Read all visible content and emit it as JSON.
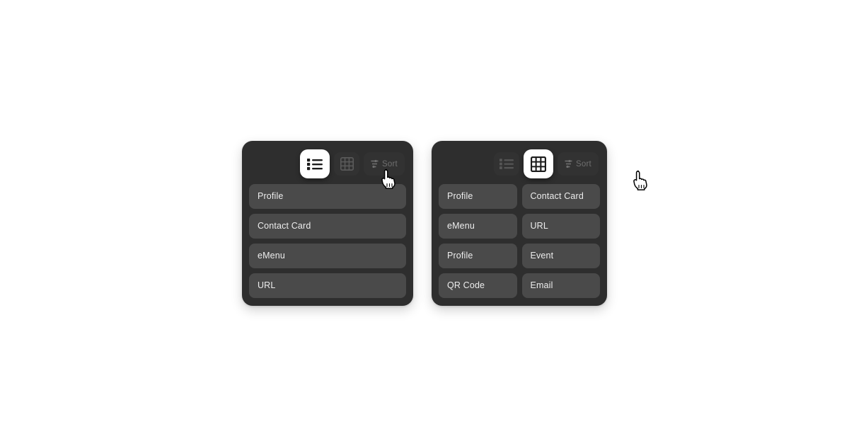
{
  "page": {
    "background_color": "#ffffff",
    "card_background": "#2e2e2e",
    "row_background": "#4a4a4a",
    "accent_active": "#ffffff",
    "text_color": "#ededed"
  },
  "cards": [
    {
      "id": "list-view-card",
      "view_mode": "list",
      "toolbar": {
        "list_button": {
          "icon": "list-view-icon",
          "label": "List view",
          "state": "active"
        },
        "grid_button": {
          "icon": "grid-view-icon",
          "label": "Grid view",
          "state": "inactive"
        },
        "sort_button": {
          "icon": "sort-icon",
          "label": "Sort",
          "state": "disabled"
        }
      },
      "items": [
        {
          "label": "Profile"
        },
        {
          "label": "Contact Card"
        },
        {
          "label": "eMenu"
        },
        {
          "label": "URL"
        }
      ],
      "cursor": {
        "icon": "pointing-hand-cursor",
        "over": "list-view-icon"
      }
    },
    {
      "id": "grid-view-card",
      "view_mode": "grid",
      "toolbar": {
        "list_button": {
          "icon": "list-view-icon",
          "label": "List view",
          "state": "inactive"
        },
        "grid_button": {
          "icon": "grid-view-icon",
          "label": "Grid view",
          "state": "active"
        },
        "sort_button": {
          "icon": "sort-icon",
          "label": "Sort",
          "state": "disabled"
        }
      },
      "items": [
        {
          "label": "Profile"
        },
        {
          "label": "Contact Card"
        },
        {
          "label": "eMenu"
        },
        {
          "label": "URL"
        },
        {
          "label": "Profile"
        },
        {
          "label": "Event"
        },
        {
          "label": "QR Code"
        },
        {
          "label": "Email"
        }
      ],
      "cursor": {
        "icon": "pointing-hand-cursor",
        "over": "grid-view-icon"
      }
    }
  ]
}
